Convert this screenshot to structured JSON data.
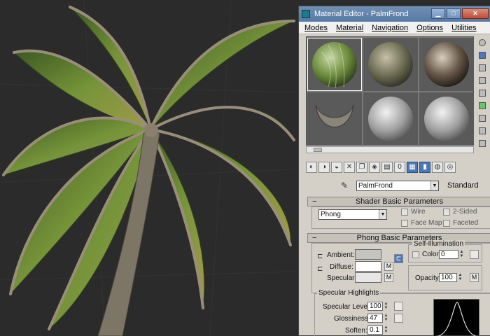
{
  "window": {
    "title": "Material Editor - PalmFrond",
    "buttons": {
      "minimize": "▁",
      "maximize": "□",
      "close": "✕"
    }
  },
  "menu": [
    "Modes",
    "Material",
    "Navigation",
    "Options",
    "Utilities"
  ],
  "material": {
    "name": "PalmFrond",
    "type": "Standard"
  },
  "shader_basic": {
    "title": "Shader Basic Parameters",
    "shader": "Phong",
    "wire": "Wire",
    "two_sided": "2-Sided",
    "face_map": "Face Map",
    "faceted": "Faceted"
  },
  "phong_basic": {
    "title": "Phong Basic Parameters",
    "self_illum_title": "Self-Illumination",
    "color_label": "Color",
    "color_value": "0",
    "ambient_label": "Ambient:",
    "diffuse_label": "Diffuse:",
    "specular_label": "Specular:",
    "m_label": "M",
    "opacity_label": "Opacity:",
    "opacity_value": "100",
    "ambient_color": "#c6c4c0",
    "diffuse_color": "#ffffff",
    "specular_color": "#e6e6e6"
  },
  "specular_highlights": {
    "title": "Specular Highlights",
    "level_label": "Specular Level:",
    "level_value": "100",
    "gloss_label": "Glossiness:",
    "gloss_value": "47",
    "soften_label": "Soften:",
    "soften_value": "0.1"
  },
  "colors": {
    "title_bar": "#5779a2",
    "panel_bg": "#d4d0c8",
    "viewport_bg": "#2b2b2b",
    "active_tool": "#4a78b8"
  }
}
